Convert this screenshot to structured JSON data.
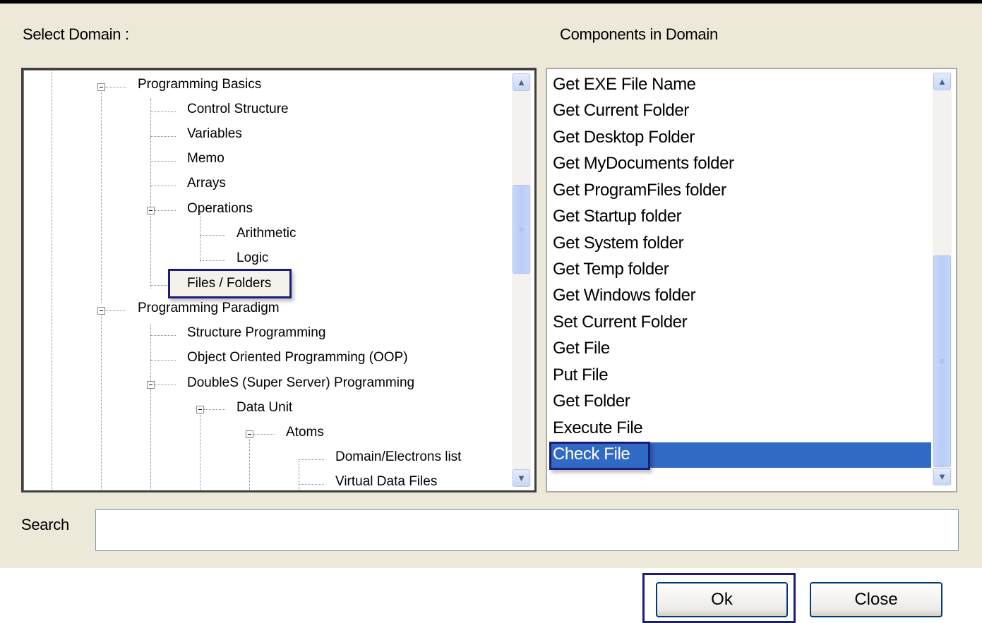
{
  "labels": {
    "select_domain": "Select Domain :",
    "components_in_domain": "Components in Domain",
    "search": "Search"
  },
  "tree": {
    "nodes": [
      {
        "label": "Programming Basics",
        "level": 0,
        "expanded": true
      },
      {
        "label": "Control Structure",
        "level": 1
      },
      {
        "label": "Variables",
        "level": 1
      },
      {
        "label": "Memo",
        "level": 1
      },
      {
        "label": "Arrays",
        "level": 1
      },
      {
        "label": "Operations",
        "level": 1,
        "expanded": true
      },
      {
        "label": "Arithmetic",
        "level": 2
      },
      {
        "label": "Logic",
        "level": 2
      },
      {
        "label": "Files / Folders",
        "level": 1,
        "selected": true
      },
      {
        "label": "Programming Paradigm",
        "level": 0,
        "expanded": true
      },
      {
        "label": "Structure Programming",
        "level": 1
      },
      {
        "label": "Object Oriented Programming (OOP)",
        "level": 1
      },
      {
        "label": "DoubleS (Super Server) Programming",
        "level": 1,
        "expanded": true
      },
      {
        "label": "Data Unit",
        "level": 2,
        "expanded": true
      },
      {
        "label": "Atoms",
        "level": 3,
        "expanded": true
      },
      {
        "label": "Domain/Electrons list",
        "level": 4
      },
      {
        "label": "Virtual Data Files",
        "level": 4
      }
    ]
  },
  "components": {
    "items": [
      "Get EXE File Name",
      "Get Current Folder",
      "Get Desktop Folder",
      "Get MyDocuments folder",
      "Get ProgramFiles folder",
      "Get Startup folder",
      "Get System folder",
      "Get Temp folder",
      "Get  Windows folder",
      "Set Current Folder",
      "Get File",
      "Put File",
      "Get Folder",
      "Execute File",
      "Check File"
    ],
    "selected": "Check File"
  },
  "search": {
    "value": ""
  },
  "buttons": {
    "ok": "Ok",
    "close": "Close"
  },
  "icons": {
    "scroll_up": "scroll-up-arrow",
    "scroll_down": "scroll-down-arrow",
    "tree_expander": "minus-box"
  },
  "colors": {
    "dialog_bg": "#ece9d8",
    "selection": "#316ac5",
    "highlight_border": "#1c1c7a",
    "scroll_thumb": "#c1d3fb"
  }
}
